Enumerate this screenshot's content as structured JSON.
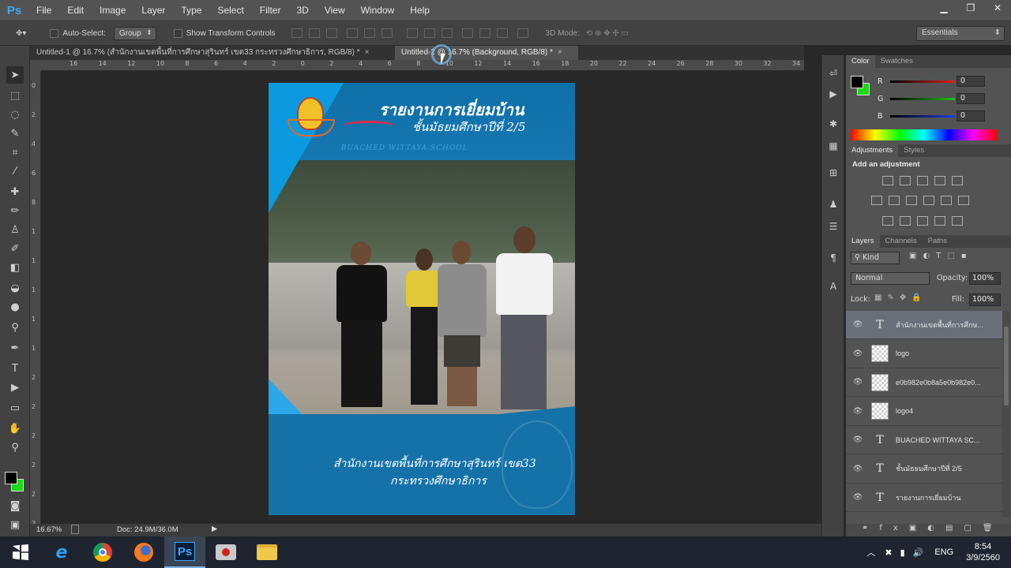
{
  "app": {
    "logo": "Ps"
  },
  "menu": [
    "File",
    "Edit",
    "Image",
    "Layer",
    "Type",
    "Select",
    "Filter",
    "3D",
    "View",
    "Window",
    "Help"
  ],
  "window_controls": {
    "minimize": "▁",
    "maximize": "❐",
    "close": "✕"
  },
  "options": {
    "auto_select_label": "Auto-Select:",
    "auto_select_value": "Group",
    "transform_label": "Show Transform Controls",
    "mode_3d_label": "3D Mode:",
    "workspace": "Essentials"
  },
  "tabs": [
    {
      "label": "Untitled-1 @ 16.7% (สำนักงานเขตพื้นที่การศึกษาสุรินทร์ เขต33 กระทรวงศึกษาธิการ, RGB/8) *",
      "close": "×"
    },
    {
      "label": "Untitled-2 @ 16.7% (Background, RGB/8) *",
      "close": "×"
    }
  ],
  "ruler_top": [
    "16",
    "14",
    "12",
    "10",
    "8",
    "6",
    "4",
    "2",
    "0",
    "2",
    "4",
    "6",
    "8",
    "10",
    "12",
    "14",
    "16",
    "18",
    "20",
    "22",
    "24",
    "26",
    "28",
    "30",
    "32",
    "34",
    "36"
  ],
  "ruler_left": [
    "0",
    "2",
    "4",
    "6",
    "8",
    "1",
    "1",
    "1",
    "1",
    "1",
    "2",
    "2",
    "2",
    "2",
    "2",
    "3"
  ],
  "document": {
    "title_line1": "รายงานการเยี่ยมบ้าน",
    "title_line2": "ชั้นมัธยมศึกษาปีที่ 2/5",
    "school_en": "BUACHED WITTAYA SCHOOL",
    "footer_line1": "สำนักงานเขตพื้นที่การศึกษาสุรินทร์ เขต33",
    "footer_line2": "กระทรวงศึกษาธิการ"
  },
  "panels": {
    "color_tabs": [
      "Color",
      "Swatches"
    ],
    "rgb": [
      {
        "label": "R",
        "value": "0",
        "color": "#e02020"
      },
      {
        "label": "G",
        "value": "0",
        "color": "#20c020"
      },
      {
        "label": "B",
        "value": "0",
        "color": "#2040e0"
      }
    ],
    "adjust_tabs": [
      "Adjustments",
      "Styles"
    ],
    "add_adjustment": "Add an adjustment",
    "layers_tabs": [
      "Layers",
      "Channels",
      "Paths"
    ],
    "kind": "Kind",
    "blend_mode": "Normal",
    "opacity_label": "Opacity:",
    "opacity_value": "100%",
    "lock_label": "Lock:",
    "fill_label": "Fill:",
    "fill_value": "100%",
    "layers": [
      {
        "name": "สำนักงานเขตพื้นที่การศึกษ...",
        "type": "text",
        "selected": true
      },
      {
        "name": "logo",
        "type": "image",
        "selected": false
      },
      {
        "name": "e0b982e0b8a5e0b982e0...",
        "type": "image",
        "selected": false
      },
      {
        "name": "logo4",
        "type": "image",
        "selected": false
      },
      {
        "name": "BUACHED WITTAYA SC...",
        "type": "text",
        "selected": false
      },
      {
        "name": "ชั้นมัธยมศึกษาปีที่ 2/5",
        "type": "text",
        "selected": false
      },
      {
        "name": "รายงานการเยี่ยมบ้าน",
        "type": "text",
        "selected": false
      }
    ]
  },
  "status": {
    "zoom": "16.67%",
    "doc": "Doc: 24.9M/36.0M"
  },
  "taskbar": {
    "apps": [
      "windows-start",
      "internet-explorer",
      "chrome",
      "firefox",
      "photoshop",
      "media",
      "file-explorer"
    ],
    "ps_label": "Ps",
    "lang": "ENG",
    "time": "8:54",
    "date": "3/9/2560"
  }
}
